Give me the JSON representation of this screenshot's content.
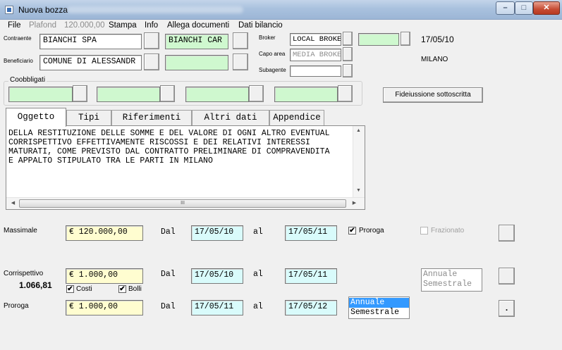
{
  "window": {
    "title": "Nuova bozza",
    "controls": {
      "minimize": "–",
      "maximize": "□",
      "close": "✕"
    }
  },
  "menu": {
    "file": "File",
    "plafond_label": "Plafond",
    "plafond_value": "120.000,00",
    "stampa": "Stampa",
    "info": "Info",
    "allega": "Allega documenti",
    "dati_bilancio": "Dati bilancio"
  },
  "header": {
    "contraente_label": "Contraente",
    "contraente_value": "BIANCHI SPA",
    "contraente_code": "BIANCHI CAR",
    "beneficiario_label": "Beneficiario",
    "beneficiario_value": "COMUNE DI ALESSANDR",
    "beneficiario_code": "",
    "broker_label": "Broker",
    "broker_value": "LOCAL BROKE",
    "broker_code": "",
    "capo_area_label": "Capo area",
    "capo_area_value": "MEDIA BROKE",
    "subagente_label": "Subagente",
    "subagente_value": "",
    "date": "17/05/10",
    "city": "MILANO"
  },
  "coobbligati": {
    "label": "Coobbligati",
    "fields": [
      "",
      "",
      "",
      ""
    ]
  },
  "fideiussione_button": "Fideiussione sottoscritta",
  "tabs": [
    "Oggetto",
    "Tipi",
    "Riferimenti",
    "Altri dati",
    "Appendice"
  ],
  "oggetto_text": "DELLA RESTITUZIONE DELLE SOMME E DEL VALORE DI OGNI ALTRO EVENTUAL\nCORRISPETTIVO EFFETTIVAMENTE RISCOSSI E DEI RELATIVI INTERESSI\nMATURATI, COME PREVISTO DAL CONTRATTO PRELIMINARE DI COMPRAVENDITA\nE APPALTO STIPULATO TRA LE PARTI IN MILANO",
  "scroll_glyph": "III",
  "massimale": {
    "label": "Massimale",
    "amount": "€ 120.000,00",
    "dal_label": "Dal",
    "dal": "17/05/10",
    "al_label": "al",
    "al": "17/05/11",
    "proroga_label": "Proroga",
    "proroga_checked": true,
    "frazionato_label": "Frazionato",
    "frazionato_checked": false
  },
  "corrispettivo": {
    "label": "Corrispettivo",
    "total": "1.066,81",
    "amount": "€ 1.000,00",
    "dal_label": "Dal",
    "dal": "17/05/10",
    "al_label": "al",
    "al": "17/05/11",
    "costi_label": "Costi",
    "bolli_label": "Bolli",
    "periodicity_options": [
      "Annuale",
      "Semestrale"
    ]
  },
  "proroga": {
    "label": "Proroga",
    "amount": "€ 1.000,00",
    "dal_label": "Dal",
    "dal": "17/05/11",
    "al_label": "al",
    "al": "17/05/12",
    "periodicity_options": [
      "Annuale",
      "Semestrale"
    ],
    "selected": "Annuale",
    "dot_button": "."
  },
  "check_mark": "✔"
}
